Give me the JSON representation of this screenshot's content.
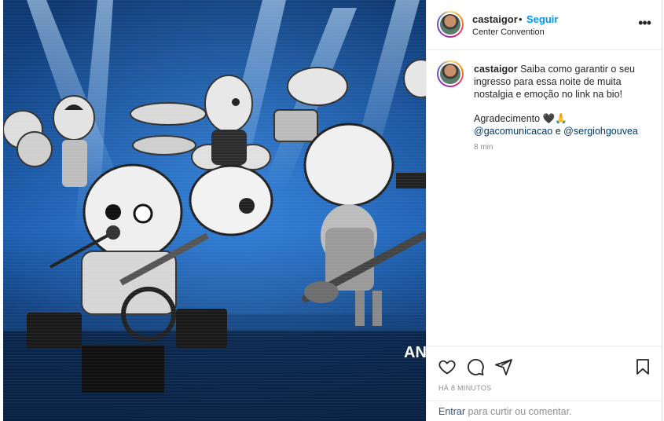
{
  "post": {
    "username": "castaigor",
    "dot": "•",
    "follow_label": "Seguir",
    "location": "Center Convention",
    "more_label": "•••"
  },
  "caption": {
    "username": "castaigor",
    "text": "Saiba como garantir o seu ingresso para essa noite de muita nostalgia e emoção no link na bio!",
    "thanks": "Agradecimento 🖤🙏",
    "mention_1": "@gacomunicacao",
    "connector": "e",
    "mention_2": "@sergiohgouvea",
    "time": "8 min"
  },
  "actions": {
    "like_icon": "heart-icon",
    "comment_icon": "comment-icon",
    "share_icon": "send-icon",
    "save_icon": "bookmark-icon",
    "date": "HÁ 8 MINUTOS"
  },
  "comment_box": {
    "login_link": "Entrar",
    "rest": "para curtir ou comentar."
  },
  "image": {
    "watermark": "AN",
    "colors": {
      "background": "#0b2a55",
      "accent_blue": "#1e6fd9",
      "follow": "#0095f6"
    }
  }
}
